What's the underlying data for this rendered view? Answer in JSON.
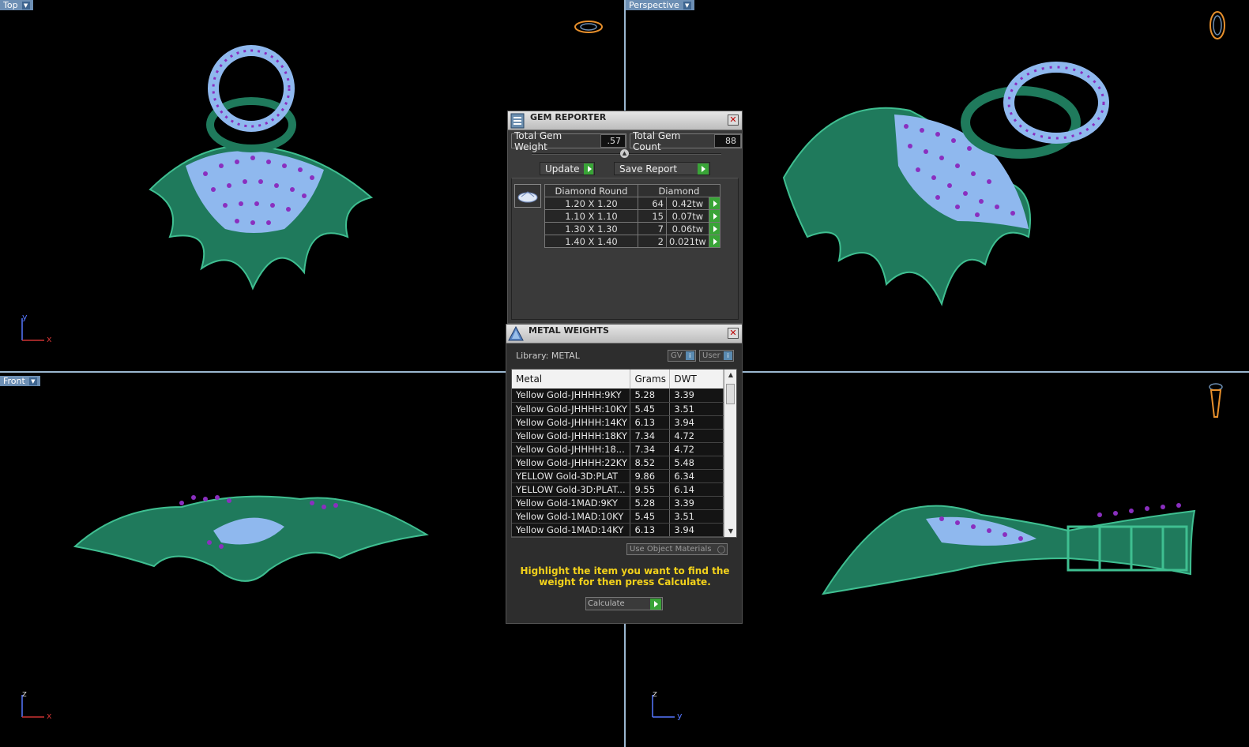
{
  "viewports": {
    "top": {
      "label": "Top"
    },
    "perspective": {
      "label": "Perspective"
    },
    "front": {
      "label": "Front"
    },
    "right": {
      "label": ""
    }
  },
  "axes": {
    "top": [
      "y",
      "x"
    ],
    "front": [
      "z",
      "x"
    ],
    "right": [
      "z",
      "y"
    ]
  },
  "gem_reporter": {
    "title": "GEM REPORTER",
    "total_weight_label": "Total Gem Weight",
    "total_weight_value": ".57",
    "total_count_label": "Total Gem Count",
    "total_count_value": "88",
    "update_label": "Update",
    "save_report_label": "Save Report",
    "table": {
      "headers": [
        "Diamond Round",
        "Diamond"
      ],
      "rows": [
        {
          "size": "1.20 X 1.20",
          "count": "64",
          "weight": "0.42tw"
        },
        {
          "size": "1.10 X 1.10",
          "count": "15",
          "weight": "0.07tw"
        },
        {
          "size": "1.30 X 1.30",
          "count": "7",
          "weight": "0.06tw"
        },
        {
          "size": "1.40 X 1.40",
          "count": "2",
          "weight": "0.021tw"
        }
      ]
    }
  },
  "metal_weights": {
    "title": "METAL WEIGHTS",
    "library_label": "Library: METAL",
    "gv_label": "GV",
    "user_label": "User",
    "headers": [
      "Metal",
      "Grams",
      "DWT"
    ],
    "rows": [
      {
        "metal": "Yellow Gold-JHHHH:9KY",
        "grams": "5.28",
        "dwt": "3.39"
      },
      {
        "metal": "Yellow Gold-JHHHH:10KY",
        "grams": "5.45",
        "dwt": "3.51"
      },
      {
        "metal": "Yellow Gold-JHHHH:14KY",
        "grams": "6.13",
        "dwt": "3.94"
      },
      {
        "metal": "Yellow Gold-JHHHH:18KY",
        "grams": "7.34",
        "dwt": "4.72"
      },
      {
        "metal": "Yellow Gold-JHHHH:18...",
        "grams": "7.34",
        "dwt": "4.72"
      },
      {
        "metal": "Yellow Gold-JHHHH:22KY",
        "grams": "8.52",
        "dwt": "5.48"
      },
      {
        "metal": "YELLOW Gold-3D:PLAT",
        "grams": "9.86",
        "dwt": "6.34"
      },
      {
        "metal": "YELLOW Gold-3D:PLAT...",
        "grams": "9.55",
        "dwt": "6.14"
      },
      {
        "metal": "Yellow Gold-1MAD:9KY",
        "grams": "5.28",
        "dwt": "3.39"
      },
      {
        "metal": "Yellow Gold-1MAD:10KY",
        "grams": "5.45",
        "dwt": "3.51"
      },
      {
        "metal": "Yellow Gold-1MAD:14KY",
        "grams": "6.13",
        "dwt": "3.94"
      }
    ],
    "use_object_materials_label": "Use Object Materials",
    "hint": "Highlight the item you want to find the weight for then press Calculate.",
    "calculate_label": "Calculate"
  },
  "colors": {
    "model_green": "#1f7a5c",
    "gem_blue": "#8fb8ee",
    "prong_purple": "#8a2fbf",
    "accent_green": "#39a437",
    "hint_yellow": "#f3d21b"
  }
}
